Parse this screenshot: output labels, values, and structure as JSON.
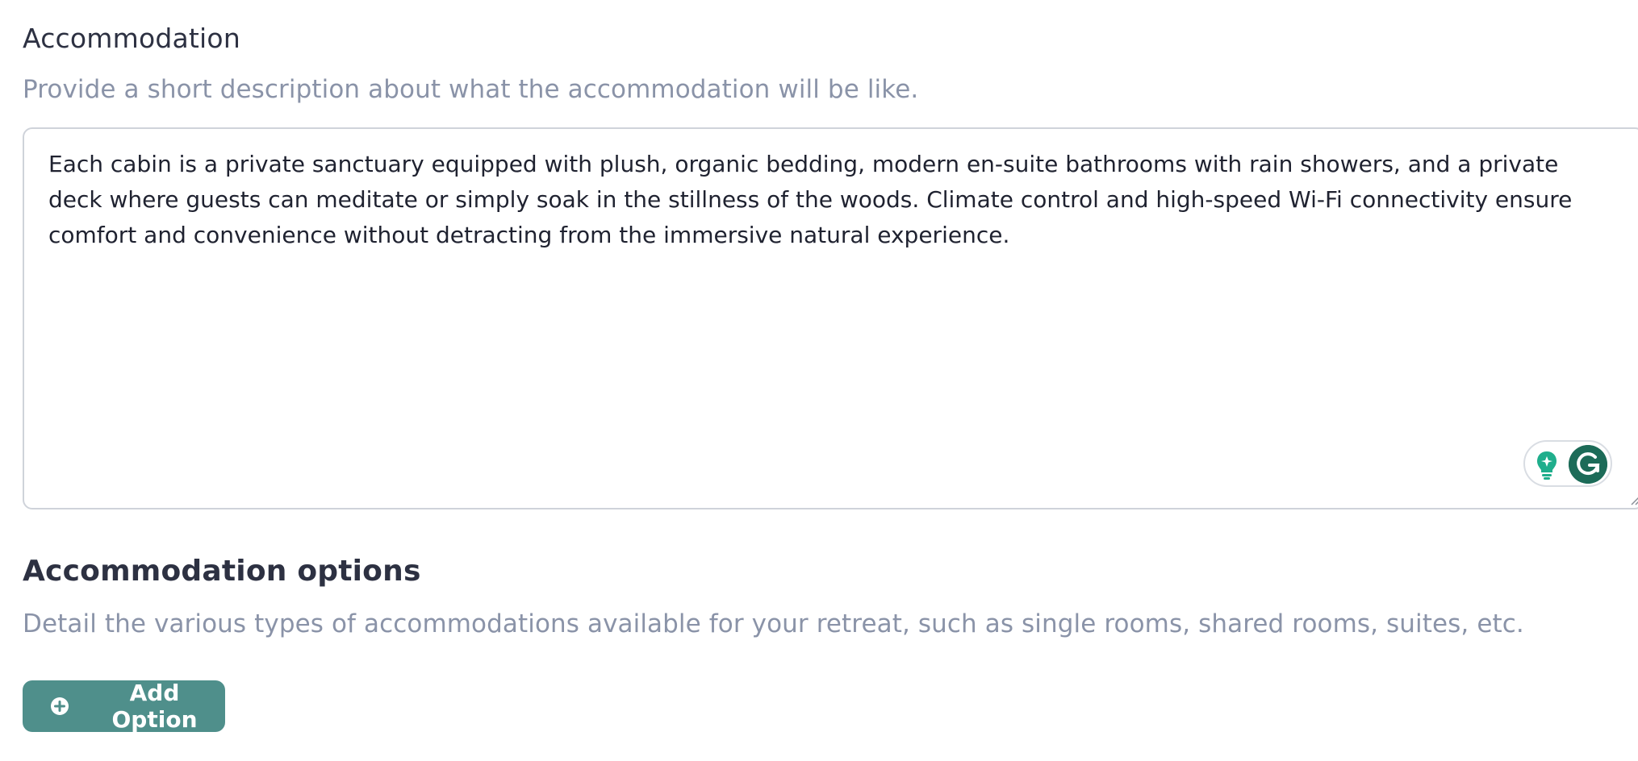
{
  "accommodation": {
    "title": "Accommodation",
    "helper": "Provide a short description about what the accommodation will be like.",
    "description_value": "Each cabin is a private sanctuary equipped with plush, organic bedding, modern en-suite bathrooms with rain showers, and a private deck where guests can meditate or simply soak in the stillness of the woods. Climate control and high-speed Wi-Fi connectivity ensure comfort and convenience without detracting from the immersive natural experience."
  },
  "grammarly_widget": {
    "icons": [
      "lightbulb-icon",
      "grammarly-logo-icon"
    ],
    "colors": {
      "bulb": "#1fae8c",
      "logo": "#1c6b58"
    }
  },
  "accommodation_options": {
    "title": "Accommodation options",
    "helper": "Detail the various types of accommodations available for your retreat, such as single rooms, shared rooms, suites, etc.",
    "add_button_label": "Add Option",
    "add_button_icon": "plus-circle-icon"
  },
  "colors": {
    "button_bg": "#4f8f8b",
    "title_text": "#2d3142",
    "helper_text": "#8a93a8",
    "border": "#cfd3da"
  }
}
